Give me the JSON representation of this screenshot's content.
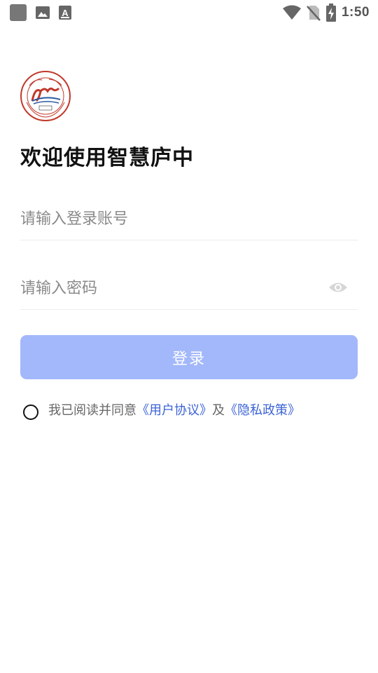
{
  "status_bar": {
    "time": "1:50",
    "left_icons": [
      "app-square-icon",
      "gallery-icon",
      "font-a-icon"
    ],
    "right_icons": [
      "wifi-icon",
      "no-sim-icon",
      "battery-charging-icon"
    ]
  },
  "login": {
    "title": "欢迎使用智慧庐中",
    "account_placeholder": "请输入登录账号",
    "account_value": "",
    "password_placeholder": "请输入密码",
    "password_value": "",
    "login_button": "登录"
  },
  "agreement": {
    "prefix": "我已阅读并同意",
    "user_agreement": "《用户协议》",
    "conjunction": "及",
    "privacy_policy": "《隐私政策》",
    "checked": false
  },
  "colors": {
    "button": "#a3b8fb",
    "link": "#3c63d6",
    "title": "#111111",
    "logo": "#c0392b"
  }
}
